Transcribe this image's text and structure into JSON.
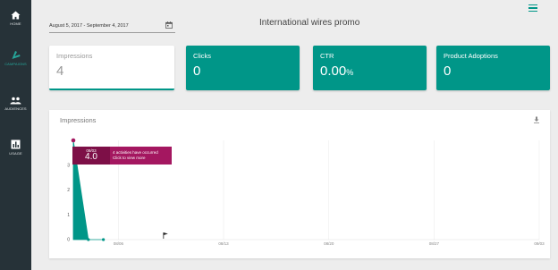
{
  "nav": {
    "items": [
      {
        "label": "HOME",
        "icon": "home-icon"
      },
      {
        "label": "CAMPAIGNS",
        "icon": "megaphone-icon",
        "active": true
      },
      {
        "label": "AUDIENCES",
        "icon": "people-icon"
      },
      {
        "label": "USAGE",
        "icon": "bar-chart-icon"
      }
    ]
  },
  "header": {
    "date_range": "August 5, 2017 - September 4, 2017",
    "title": "International wires promo"
  },
  "cards": [
    {
      "label": "Impressions",
      "value": "4"
    },
    {
      "label": "Clicks",
      "value": "0"
    },
    {
      "label": "CTR",
      "value": "0.00",
      "suffix": "%"
    },
    {
      "label": "Product Adoptions",
      "value": "0"
    }
  ],
  "chart_panel": {
    "title": "Impressions",
    "tooltip": {
      "date": "08/03",
      "value": "4.0",
      "line1": "4 activities have occurred",
      "line2": "Click to view more"
    }
  },
  "chart_data": {
    "type": "area",
    "x": [
      "08/03",
      "08/04",
      "08/05"
    ],
    "values": [
      4,
      0,
      0
    ],
    "x_tick_labels": [
      "08/06",
      "08/13",
      "08/20",
      "08/27",
      "09/03"
    ],
    "y_tick_labels": [
      "3",
      "2",
      "1",
      "0"
    ],
    "ylim": [
      0,
      4
    ],
    "grid": true,
    "series_color": "#009688",
    "flags": [
      "08/09"
    ]
  },
  "colors": {
    "accent": "#009688",
    "sidebar": "#263238",
    "tooltip": "#a41760"
  }
}
